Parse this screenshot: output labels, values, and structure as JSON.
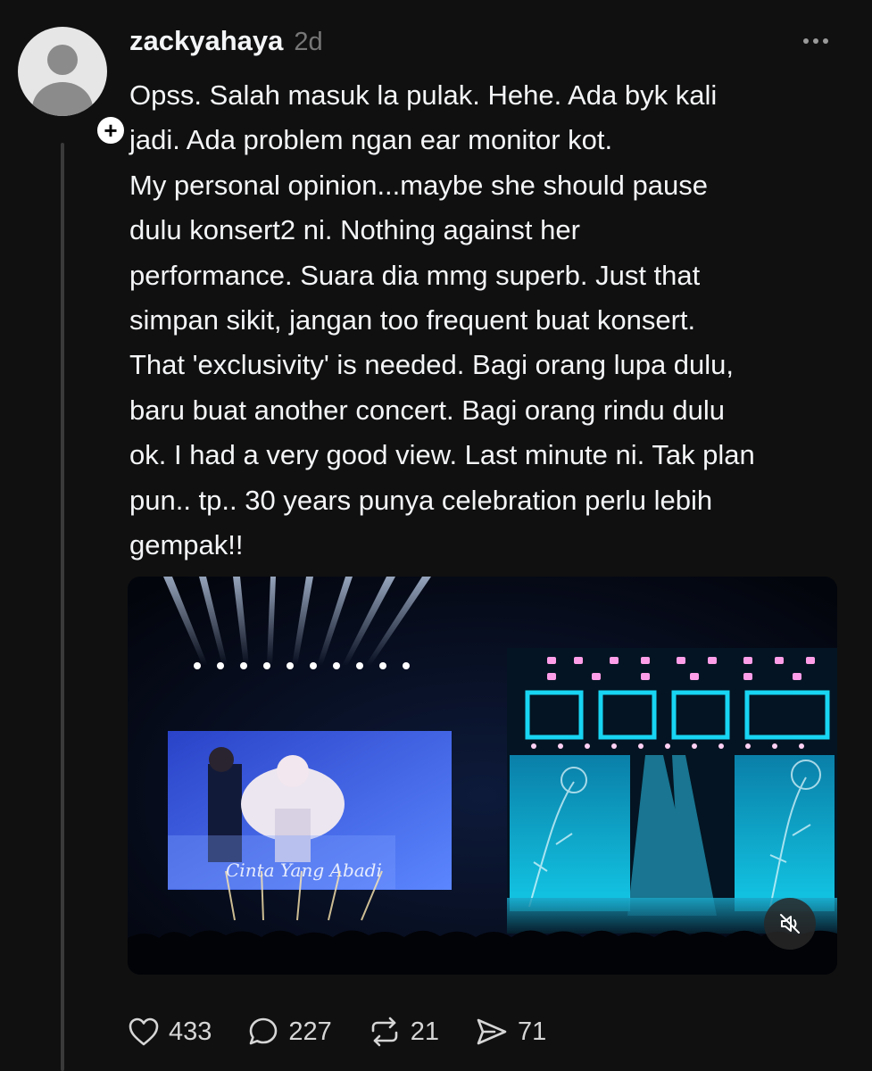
{
  "post": {
    "username": "zackyahaya",
    "timestamp": "2d",
    "text_lines": [
      "Opss. Salah masuk la pulak. Hehe. Ada byk kali",
      "jadi. Ada problem ngan ear monitor kot.",
      "My personal opinion...maybe she should pause",
      "dulu konsert2  ni. Nothing against her",
      "performance. Suara dia mmg superb. Just that",
      "simpan sikit,  jangan too frequent buat konsert.",
      "That 'exclusivity' is needed. Bagi orang lupa dulu,",
      "baru buat another concert. Bagi orang rindu dulu",
      "ok. I had a very good view. Last minute ni. Tak plan",
      "pun.. tp.. 30 years punya celebration perlu lebih",
      "gempak!!"
    ],
    "screen_caption": "Cinta Yang Abadi"
  },
  "actions": {
    "likes": "433",
    "replies": "227",
    "reposts": "21",
    "shares": "71"
  },
  "icons": {
    "like": "heart-icon",
    "reply": "comment-bubble-icon",
    "repost": "repost-arrows-icon",
    "share": "send-paper-plane-icon",
    "more": "more-dots-icon",
    "mute": "muted-speaker-icon",
    "follow": "plus-icon"
  },
  "colors": {
    "background": "#101010",
    "text": "#f3f5f7",
    "muted": "#777777",
    "stage_cyan": "#19e0ff",
    "stage_pink": "#ff9ee8"
  }
}
